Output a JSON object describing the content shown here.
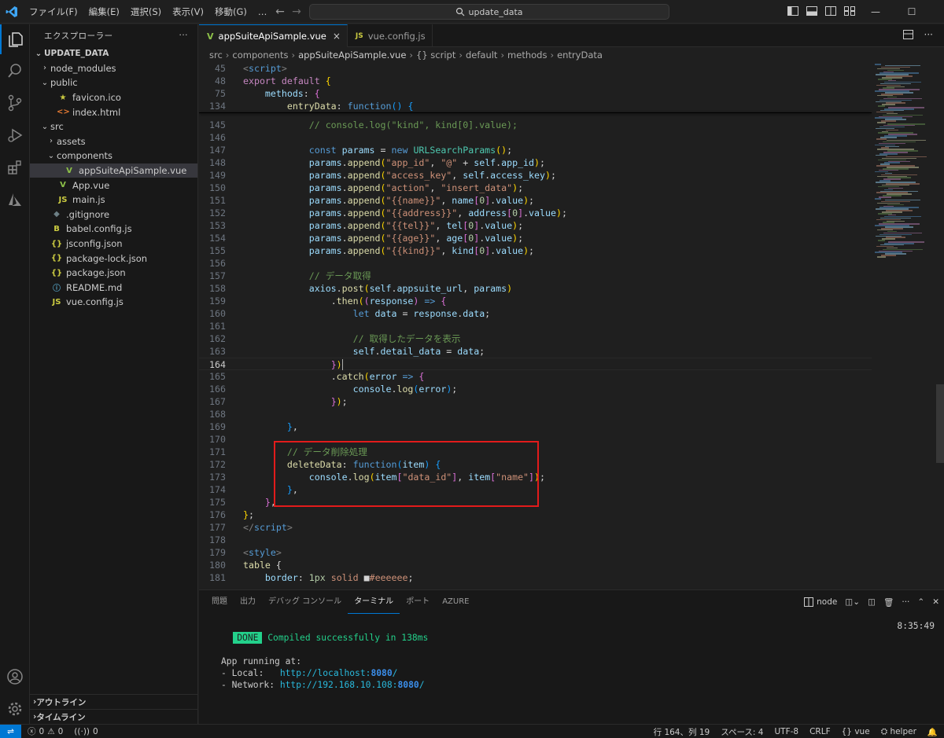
{
  "titlebar": {
    "menu": [
      "ファイル(F)",
      "編集(E)",
      "選択(S)",
      "表示(V)",
      "移動(G)",
      "…"
    ],
    "search_text": "update_data",
    "nav_back": "←",
    "nav_forward": "→"
  },
  "sidebar": {
    "title": "エクスプローラー",
    "more": "···",
    "root": "UPDATE_DATA",
    "tree": [
      {
        "label": "node_modules",
        "depth": 1,
        "type": "folder-closed",
        "icon": ""
      },
      {
        "label": "public",
        "depth": 1,
        "type": "folder-open",
        "icon": ""
      },
      {
        "label": "favicon.ico",
        "depth": 2,
        "type": "file",
        "icon": "★",
        "color": "#cbcb41"
      },
      {
        "label": "index.html",
        "depth": 2,
        "type": "file",
        "icon": "<>",
        "color": "#e37933"
      },
      {
        "label": "src",
        "depth": 1,
        "type": "folder-open",
        "icon": ""
      },
      {
        "label": "assets",
        "depth": 2,
        "type": "folder-closed",
        "icon": ""
      },
      {
        "label": "components",
        "depth": 2,
        "type": "folder-open",
        "icon": ""
      },
      {
        "label": "appSuiteApiSample.vue",
        "depth": 3,
        "type": "file",
        "icon": "V",
        "color": "#8dc149",
        "selected": true
      },
      {
        "label": "App.vue",
        "depth": 2,
        "type": "file",
        "icon": "V",
        "color": "#8dc149"
      },
      {
        "label": "main.js",
        "depth": 2,
        "type": "file",
        "icon": "JS",
        "color": "#cbcb41"
      },
      {
        "label": ".gitignore",
        "depth": 1,
        "type": "file",
        "icon": "◆",
        "color": "#6d8086"
      },
      {
        "label": "babel.config.js",
        "depth": 1,
        "type": "file",
        "icon": "B",
        "color": "#cbcb41"
      },
      {
        "label": "jsconfig.json",
        "depth": 1,
        "type": "file",
        "icon": "{}",
        "color": "#cbcb41"
      },
      {
        "label": "package-lock.json",
        "depth": 1,
        "type": "file",
        "icon": "{}",
        "color": "#cbcb41"
      },
      {
        "label": "package.json",
        "depth": 1,
        "type": "file",
        "icon": "{}",
        "color": "#cbcb41"
      },
      {
        "label": "README.md",
        "depth": 1,
        "type": "file",
        "icon": "ⓘ",
        "color": "#519aba"
      },
      {
        "label": "vue.config.js",
        "depth": 1,
        "type": "file",
        "icon": "JS",
        "color": "#cbcb41"
      }
    ],
    "outline": "アウトライン",
    "timeline": "タイムライン"
  },
  "tabs": [
    {
      "label": "appSuiteApiSample.vue",
      "icon": "V",
      "active": true,
      "close": "×"
    },
    {
      "label": "vue.config.js",
      "icon": "JS",
      "active": false
    }
  ],
  "breadcrumb": [
    "src",
    "components",
    "appSuiteApiSample.vue",
    "{} script",
    "default",
    "methods",
    "entryData"
  ],
  "code": {
    "sticky": [
      {
        "ln": "45",
        "html": "<span class=\"tag\">&lt;</span><span class=\"tagn\">script</span><span class=\"tag\">&gt;</span>"
      },
      {
        "ln": "48",
        "html": "<span class=\"ctl\">export</span> <span class=\"ctl\">default</span> <span class=\"br1\">{</span>"
      },
      {
        "ln": "75",
        "html": "    <span class=\"var\">methods</span><span class=\"pl\">: </span><span class=\"br2\">{</span>"
      },
      {
        "ln": "134",
        "html": "        <span class=\"fn\">entryData</span><span class=\"pl\">: </span><span class=\"kw\">function</span><span class=\"br3\">()</span> <span class=\"br3\">{</span>"
      }
    ],
    "lines": [
      {
        "ln": "145",
        "html": "            <span class=\"cmt\">// console.log(\"kind\", kind[0].value);</span>"
      },
      {
        "ln": "146",
        "html": ""
      },
      {
        "ln": "147",
        "html": "            <span class=\"kw\">const</span> <span class=\"var\">params</span> <span class=\"pl\">=</span> <span class=\"kw\">new</span> <span class=\"cls\">URLSearchParams</span><span class=\"br1\">()</span><span class=\"pl\">;</span>"
      },
      {
        "ln": "148",
        "html": "            <span class=\"var\">params</span><span class=\"pl\">.</span><span class=\"fn\">append</span><span class=\"br1\">(</span><span class=\"str\">\"app_id\"</span><span class=\"pl\">, </span><span class=\"str\">\"@\"</span> <span class=\"pl\">+</span> <span class=\"var\">self</span><span class=\"pl\">.</span><span class=\"var\">app_id</span><span class=\"br1\">)</span><span class=\"pl\">;</span>"
      },
      {
        "ln": "149",
        "html": "            <span class=\"var\">params</span><span class=\"pl\">.</span><span class=\"fn\">append</span><span class=\"br1\">(</span><span class=\"str\">\"access_key\"</span><span class=\"pl\">, </span><span class=\"var\">self</span><span class=\"pl\">.</span><span class=\"var\">access_key</span><span class=\"br1\">)</span><span class=\"pl\">;</span>"
      },
      {
        "ln": "150",
        "html": "            <span class=\"var\">params</span><span class=\"pl\">.</span><span class=\"fn\">append</span><span class=\"br1\">(</span><span class=\"str\">\"action\"</span><span class=\"pl\">, </span><span class=\"str\">\"insert_data\"</span><span class=\"br1\">)</span><span class=\"pl\">;</span>"
      },
      {
        "ln": "151",
        "html": "            <span class=\"var\">params</span><span class=\"pl\">.</span><span class=\"fn\">append</span><span class=\"br1\">(</span><span class=\"str\">\"{{name}}\"</span><span class=\"pl\">, </span><span class=\"var\">name</span><span class=\"br2\">[</span><span class=\"num\">0</span><span class=\"br2\">]</span><span class=\"pl\">.</span><span class=\"var\">value</span><span class=\"br1\">)</span><span class=\"pl\">;</span>"
      },
      {
        "ln": "152",
        "html": "            <span class=\"var\">params</span><span class=\"pl\">.</span><span class=\"fn\">append</span><span class=\"br1\">(</span><span class=\"str\">\"{{address}}\"</span><span class=\"pl\">, </span><span class=\"var\">address</span><span class=\"br2\">[</span><span class=\"num\">0</span><span class=\"br2\">]</span><span class=\"pl\">.</span><span class=\"var\">value</span><span class=\"br1\">)</span><span class=\"pl\">;</span>"
      },
      {
        "ln": "153",
        "html": "            <span class=\"var\">params</span><span class=\"pl\">.</span><span class=\"fn\">append</span><span class=\"br1\">(</span><span class=\"str\">\"{{tel}}\"</span><span class=\"pl\">, </span><span class=\"var\">tel</span><span class=\"br2\">[</span><span class=\"num\">0</span><span class=\"br2\">]</span><span class=\"pl\">.</span><span class=\"var\">value</span><span class=\"br1\">)</span><span class=\"pl\">;</span>"
      },
      {
        "ln": "154",
        "html": "            <span class=\"var\">params</span><span class=\"pl\">.</span><span class=\"fn\">append</span><span class=\"br1\">(</span><span class=\"str\">\"{{age}}\"</span><span class=\"pl\">, </span><span class=\"var\">age</span><span class=\"br2\">[</span><span class=\"num\">0</span><span class=\"br2\">]</span><span class=\"pl\">.</span><span class=\"var\">value</span><span class=\"br1\">)</span><span class=\"pl\">;</span>"
      },
      {
        "ln": "155",
        "html": "            <span class=\"var\">params</span><span class=\"pl\">.</span><span class=\"fn\">append</span><span class=\"br1\">(</span><span class=\"str\">\"{{kind}}\"</span><span class=\"pl\">, </span><span class=\"var\">kind</span><span class=\"br2\">[</span><span class=\"num\">0</span><span class=\"br2\">]</span><span class=\"pl\">.</span><span class=\"var\">value</span><span class=\"br1\">)</span><span class=\"pl\">;</span>"
      },
      {
        "ln": "156",
        "html": ""
      },
      {
        "ln": "157",
        "html": "            <span class=\"cmt\">// データ取得</span>"
      },
      {
        "ln": "158",
        "html": "            <span class=\"var\">axios</span><span class=\"pl\">.</span><span class=\"fn\">post</span><span class=\"br1\">(</span><span class=\"var\">self</span><span class=\"pl\">.</span><span class=\"var\">appsuite_url</span><span class=\"pl\">, </span><span class=\"var\">params</span><span class=\"br1\">)</span>"
      },
      {
        "ln": "159",
        "html": "                <span class=\"pl\">.</span><span class=\"fn\">then</span><span class=\"br1\">(</span><span class=\"br2\">(</span><span class=\"var\">response</span><span class=\"br2\">)</span> <span class=\"kw\">=&gt;</span> <span class=\"br2\">{</span>"
      },
      {
        "ln": "160",
        "html": "                    <span class=\"kw\">let</span> <span class=\"var\">data</span> <span class=\"pl\">=</span> <span class=\"var\">response</span><span class=\"pl\">.</span><span class=\"var\">data</span><span class=\"pl\">;</span>"
      },
      {
        "ln": "161",
        "html": ""
      },
      {
        "ln": "162",
        "html": "                    <span class=\"cmt\">// 取得したデータを表示</span>"
      },
      {
        "ln": "163",
        "html": "                    <span class=\"var\">self</span><span class=\"pl\">.</span><span class=\"var\">detail_data</span> <span class=\"pl\">=</span> <span class=\"var\">data</span><span class=\"pl\">;</span>"
      },
      {
        "ln": "164",
        "html": "                <span class=\"br2\">}</span><span class=\"br1\">)</span>",
        "current": true
      },
      {
        "ln": "165",
        "html": "                <span class=\"pl\">.</span><span class=\"fn\">catch</span><span class=\"br1\">(</span><span class=\"var\">error</span> <span class=\"kw\">=&gt;</span> <span class=\"br2\">{</span>"
      },
      {
        "ln": "166",
        "html": "                    <span class=\"var\">console</span><span class=\"pl\">.</span><span class=\"fn\">log</span><span class=\"br3\">(</span><span class=\"var\">error</span><span class=\"br3\">)</span><span class=\"pl\">;</span>"
      },
      {
        "ln": "167",
        "html": "                <span class=\"br2\">}</span><span class=\"br1\">)</span><span class=\"pl\">;</span>"
      },
      {
        "ln": "168",
        "html": ""
      },
      {
        "ln": "169",
        "html": "        <span class=\"br3\">}</span><span class=\"pl\">,</span>"
      },
      {
        "ln": "170",
        "html": ""
      },
      {
        "ln": "171",
        "html": "        <span class=\"cmt\">// データ削除処理</span>"
      },
      {
        "ln": "172",
        "html": "        <span class=\"fn\">deleteData</span><span class=\"pl\">: </span><span class=\"kw\">function</span><span class=\"br3\">(</span><span class=\"var\">item</span><span class=\"br3\">)</span> <span class=\"br3\">{</span>"
      },
      {
        "ln": "173",
        "html": "            <span class=\"var\">console</span><span class=\"pl\">.</span><span class=\"fn\">log</span><span class=\"br1\">(</span><span class=\"var\">item</span><span class=\"br2\">[</span><span class=\"str\">\"data_id\"</span><span class=\"br2\">]</span><span class=\"pl\">, </span><span class=\"var\">item</span><span class=\"br2\">[</span><span class=\"str\">\"name\"</span><span class=\"br2\">]</span><span class=\"br1\">)</span><span class=\"pl\">;</span>"
      },
      {
        "ln": "174",
        "html": "        <span class=\"br3\">}</span><span class=\"pl\">,</span>"
      },
      {
        "ln": "175",
        "html": "    <span class=\"br2\">}</span><span class=\"pl\">,</span>"
      },
      {
        "ln": "176",
        "html": "<span class=\"br1\">}</span><span class=\"pl\">;</span>"
      },
      {
        "ln": "177",
        "html": "<span class=\"tag\">&lt;/</span><span class=\"tagn\">script</span><span class=\"tag\">&gt;</span>"
      },
      {
        "ln": "178",
        "html": ""
      },
      {
        "ln": "179",
        "html": "<span class=\"tag\">&lt;</span><span class=\"tagn\">style</span><span class=\"tag\">&gt;</span>"
      },
      {
        "ln": "180",
        "html": "<span class=\"fn\">table</span> <span class=\"pl\">{</span>"
      },
      {
        "ln": "181",
        "html": "    <span class=\"var\">border</span><span class=\"pl\">: </span><span class=\"num\">1px</span> <span class=\"str\">solid</span> <span class=\"pl\">■</span><span class=\"str\">#eeeeee</span><span class=\"pl\">;</span>"
      }
    ]
  },
  "panel": {
    "tabs": [
      "問題",
      "出力",
      "デバッグ コンソール",
      "ターミナル",
      "ポート",
      "AZURE"
    ],
    "active_tab": "ターミナル",
    "shell": "node",
    "terminal": {
      "done_badge": "DONE",
      "compiled": "Compiled successfully in 138ms",
      "time": "8:35:49",
      "running": "App running at:",
      "local_label": "- Local:   ",
      "local_url": "http://localhost:",
      "local_port": "8080",
      "network_label": "- Network: ",
      "network_url": "http://192.168.10.108:",
      "network_port": "8080",
      "slash": "/"
    }
  },
  "statusbar": {
    "errors": "0",
    "warnings": "0",
    "ports": "0",
    "position": "行 164、列 19",
    "spaces": "スペース: 4",
    "encoding": "UTF-8",
    "eol": "CRLF",
    "language": "vue",
    "helper": "helper"
  },
  "colors": {
    "accent": "#0078d4",
    "highlight_box": "#e21b1b"
  }
}
